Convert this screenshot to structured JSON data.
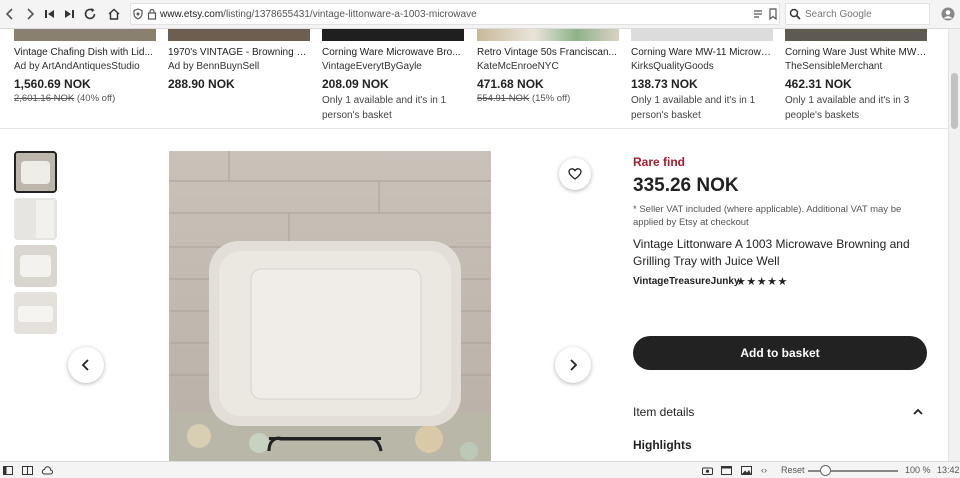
{
  "browser": {
    "url_domain": "www.etsy.com",
    "url_path": "/listing/1378655431/vintage-littonware-a-1003-microwave",
    "search_placeholder": "Search Google"
  },
  "related": [
    {
      "title": "Vintage Chafing Dish with Lid...",
      "shop": "Ad by ArtAndAntiquesStudio",
      "price": "1,560.69 NOK",
      "old_price": "2,601.16 NOK",
      "discount": "(40% off)"
    },
    {
      "title": "1970's VINTAGE - Browning sk...",
      "shop": "Ad by BennBuynSell",
      "price": "288.90 NOK"
    },
    {
      "title": "Corning Ware Microwave Bro...",
      "shop": "VintageEverytByGayle",
      "price": "208.09 NOK",
      "note": "Only 1 available and it's in 1 person's basket"
    },
    {
      "title": "Retro Vintage 50s Franciscan...",
      "shop": "KateMcEnroeNYC",
      "price": "471.68 NOK",
      "old_price": "554.91 NOK",
      "discount": "(15% off)"
    },
    {
      "title": "Corning Ware MW-11 Microwa...",
      "shop": "KirksQualityGoods",
      "price": "138.73 NOK",
      "note": "Only 1 available and it's in 1 person's basket"
    },
    {
      "title": "Corning Ware Just White MW ...",
      "shop": "TheSensibleMerchant",
      "price": "462.31 NOK",
      "note": "Only 1 available and it's in 3 people's baskets"
    }
  ],
  "product": {
    "badge": "Rare find",
    "price": "335.26 NOK",
    "vat_note": "* Seller VAT included (where applicable). Additional VAT may be applied by Etsy at checkout",
    "title": "Vintage Littonware A 1003 Microwave Browning and Grilling Tray with Juice Well",
    "shop": "VintageTreasureJunky",
    "rating_stars": "★★★★★",
    "rating": 5,
    "add_to_basket": "Add to basket",
    "item_details": "Item details",
    "highlights": "Highlights"
  },
  "statusbar": {
    "reset": "Reset",
    "zoom": "100 %",
    "time": "13:42"
  }
}
